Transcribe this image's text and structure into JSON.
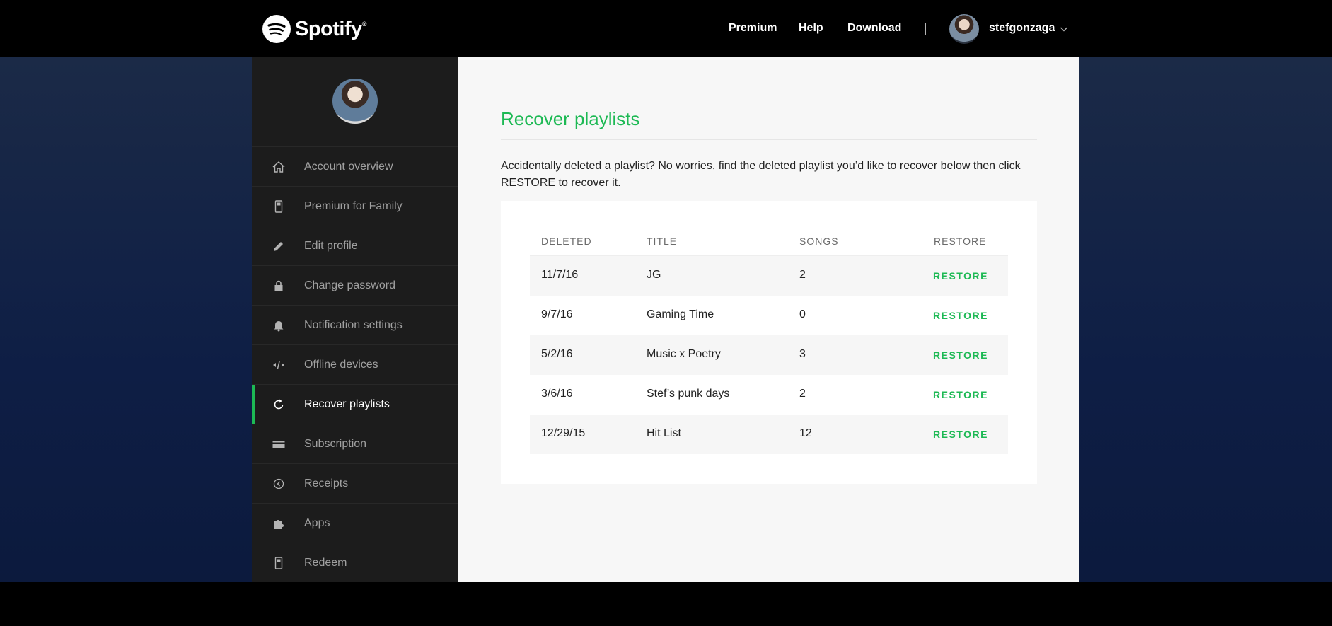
{
  "brand": {
    "name": "Spotify",
    "trademark": "®",
    "accent": "#1db954"
  },
  "topnav": {
    "links": [
      "Premium",
      "Help",
      "Download"
    ],
    "user": {
      "name": "stefgonzaga"
    }
  },
  "sidebar": {
    "items": [
      {
        "label": "Account overview",
        "icon": "home-icon"
      },
      {
        "label": "Premium for Family",
        "icon": "device-icon"
      },
      {
        "label": "Edit profile",
        "icon": "pencil-icon"
      },
      {
        "label": "Change password",
        "icon": "lock-icon"
      },
      {
        "label": "Notification settings",
        "icon": "bell-icon"
      },
      {
        "label": "Offline devices",
        "icon": "offline-icon"
      },
      {
        "label": "Recover playlists",
        "icon": "refresh-icon",
        "active": true
      },
      {
        "label": "Subscription",
        "icon": "card-icon"
      },
      {
        "label": "Receipts",
        "icon": "clock-icon"
      },
      {
        "label": "Apps",
        "icon": "puzzle-icon"
      },
      {
        "label": "Redeem",
        "icon": "device-icon"
      }
    ]
  },
  "main": {
    "title": "Recover playlists",
    "intro": "Accidentally deleted a playlist? No worries, find the deleted playlist you’d like to recover below then click RESTORE to recover it.",
    "table": {
      "headers": [
        "DELETED",
        "TITLE",
        "SONGS",
        "RESTORE"
      ],
      "rows": [
        {
          "deleted": "11/7/16",
          "title": "JG",
          "songs": "2",
          "action": "RESTORE"
        },
        {
          "deleted": "9/7/16",
          "title": "Gaming Time",
          "songs": "0",
          "action": "RESTORE"
        },
        {
          "deleted": "5/2/16",
          "title": "Music x Poetry",
          "songs": "3",
          "action": "RESTORE"
        },
        {
          "deleted": "3/6/16",
          "title": "Stef’s punk days",
          "songs": "2",
          "action": "RESTORE"
        },
        {
          "deleted": "12/29/15",
          "title": "Hit List",
          "songs": "12",
          "action": "RESTORE"
        }
      ]
    }
  }
}
